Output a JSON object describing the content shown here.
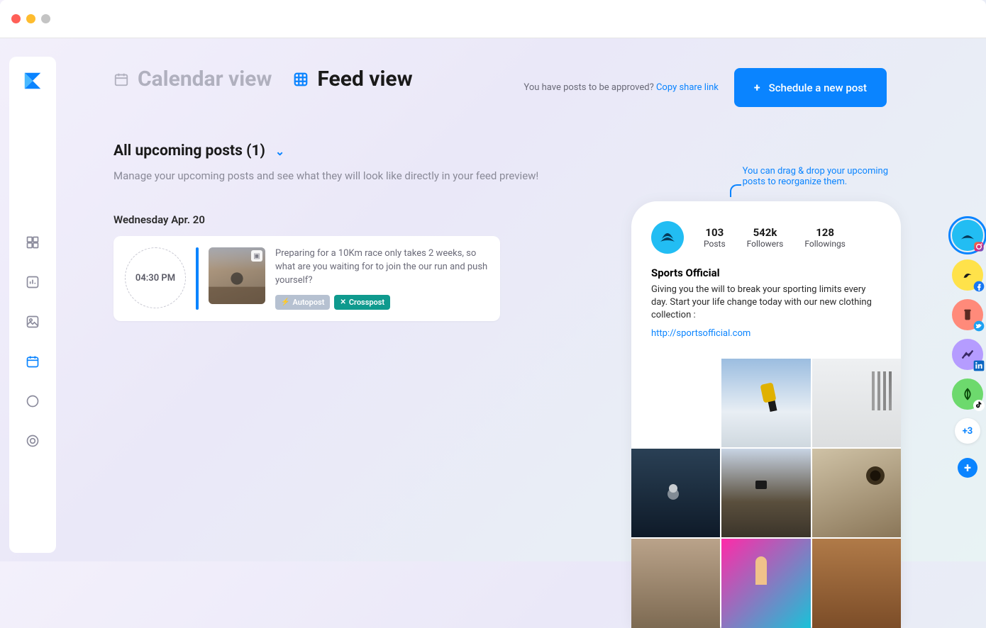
{
  "tabs": {
    "calendar": "Calendar view",
    "feed": "Feed view"
  },
  "approve": {
    "text": "You have posts to be approved? ",
    "link": "Copy share link"
  },
  "schedule_btn": "Schedule a new post",
  "section": {
    "title": "All upcoming posts (1)",
    "sub": "Manage your upcoming posts and see what they will look like directly in your feed preview!"
  },
  "drag_hint_l1": "You can drag & drop your upcoming",
  "drag_hint_l2": "posts to reorganize them.",
  "date": "Wednesday Apr. 20",
  "post": {
    "time": "04:30 PM",
    "text": "Preparing for a 10Km race only takes 2 weeks, so what are you waiting for to join the our run and push yourself?",
    "autopost": "Autopost",
    "crosspost": "Crosspost"
  },
  "profile": {
    "posts_num": "103",
    "posts_lbl": "Posts",
    "followers_num": "542k",
    "followers_lbl": "Followers",
    "followings_num": "128",
    "followings_lbl": "Followings",
    "name": "Sports Official",
    "bio": "Giving you the will to break your sporting limits every day. Start your life change today with our new clothing collection :",
    "link": "http://sportsofficial.com"
  },
  "more_accounts": "+3"
}
